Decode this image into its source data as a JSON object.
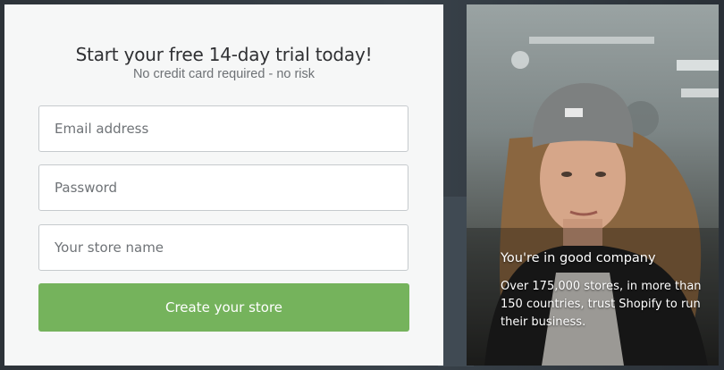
{
  "signup": {
    "title": "Start your free 14-day trial today!",
    "subtitle": "No credit card required - no risk",
    "email_placeholder": "Email address",
    "password_placeholder": "Password",
    "store_placeholder": "Your store name",
    "submit_label": "Create your store"
  },
  "promo": {
    "heading": "You're in good company",
    "body": "Over 175,000 stores, in more than 150 countries, trust Shopify to run their business.",
    "image": "woman-in-beanie-photo"
  },
  "colors": {
    "button": "#75b35c",
    "panel": "#f6f7f7",
    "backdrop": "#2b3036"
  }
}
